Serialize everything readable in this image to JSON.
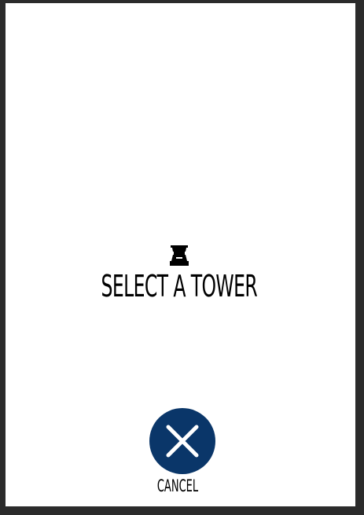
{
  "prompt": {
    "title": "SELECT A TOWER",
    "icon": "tower-icon"
  },
  "cancel": {
    "label": "CANCEL",
    "icon": "close-icon",
    "color": "#0a3669"
  }
}
